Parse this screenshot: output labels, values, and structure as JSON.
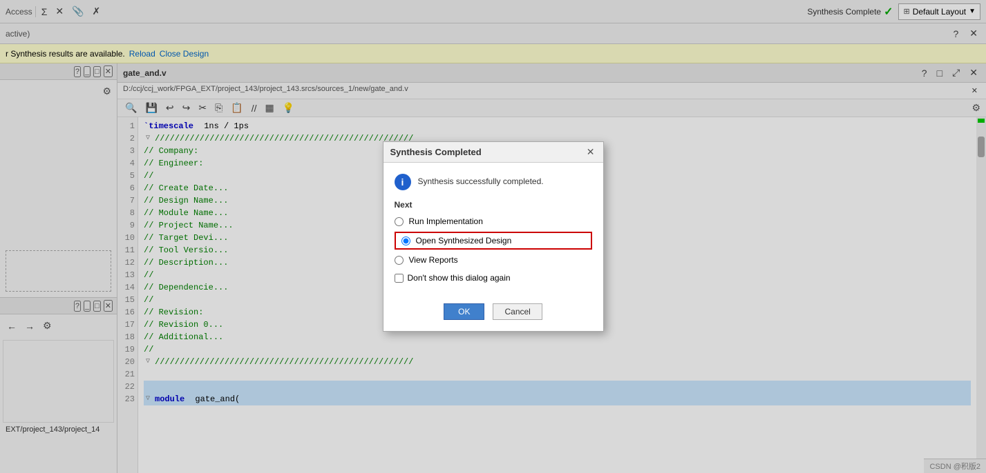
{
  "topbar": {
    "access_label": "Access",
    "synthesis_complete_label": "Synthesis Complete",
    "layout_label": "Default Layout",
    "check_symbol": "✓",
    "chevron_symbol": "▼"
  },
  "toolbar": {
    "sigma": "Σ",
    "cut": "✕",
    "clip": "🖇",
    "x_tool": "✗"
  },
  "panel": {
    "active_label": "active)"
  },
  "notification": {
    "message": "r Synthesis results are available.",
    "reload": "Reload",
    "close_design": "Close Design"
  },
  "editor": {
    "title": "gate_and.v",
    "path": "D:/ccj/ccj_work/FPGA_EXT/project_143/project_143.srcs/sources_1/new/gate_and.v",
    "path_short": "EXT/project_143/project_14"
  },
  "code_lines": [
    {
      "num": 1,
      "text": "`timescale 1ns / 1ps",
      "type": "normal"
    },
    {
      "num": 2,
      "text": "////////////////////////////////////////////////////",
      "type": "comment",
      "fold": true
    },
    {
      "num": 3,
      "text": "// Company:",
      "type": "comment"
    },
    {
      "num": 4,
      "text": "// Engineer:",
      "type": "comment"
    },
    {
      "num": 5,
      "text": "//",
      "type": "comment"
    },
    {
      "num": 6,
      "text": "// Create Date...",
      "type": "comment"
    },
    {
      "num": 7,
      "text": "// Design Name...",
      "type": "comment"
    },
    {
      "num": 8,
      "text": "// Module Name...",
      "type": "comment"
    },
    {
      "num": 9,
      "text": "// Project Name...",
      "type": "comment"
    },
    {
      "num": 10,
      "text": "// Target Device...",
      "type": "comment"
    },
    {
      "num": 11,
      "text": "// Tool Version...",
      "type": "comment"
    },
    {
      "num": 12,
      "text": "// Description...",
      "type": "comment"
    },
    {
      "num": 13,
      "text": "//",
      "type": "comment"
    },
    {
      "num": 14,
      "text": "// Dependencies...",
      "type": "comment"
    },
    {
      "num": 15,
      "text": "//",
      "type": "comment"
    },
    {
      "num": 16,
      "text": "// Revision:",
      "type": "comment"
    },
    {
      "num": 17,
      "text": "// Revision 0...",
      "type": "comment"
    },
    {
      "num": 18,
      "text": "// Additional...",
      "type": "comment"
    },
    {
      "num": 19,
      "text": "//",
      "type": "comment"
    },
    {
      "num": 20,
      "text": "////////////////////////////////////////////////////",
      "type": "comment",
      "fold": true
    },
    {
      "num": 21,
      "text": "",
      "type": "normal"
    },
    {
      "num": 22,
      "text": "",
      "type": "highlighted"
    },
    {
      "num": 23,
      "text": "module gate_and(",
      "type": "highlighted",
      "fold": true
    }
  ],
  "modal": {
    "title": "Synthesis Completed",
    "info_text": "Synthesis successfully completed.",
    "next_label": "Next",
    "option1": "Run Implementation",
    "option2": "Open Synthesized Design",
    "option3": "View Reports",
    "checkbox_label": "Don't show this dialog again",
    "ok_button": "OK",
    "cancel_button": "Cancel"
  },
  "watermark": "CSDN @积版2"
}
